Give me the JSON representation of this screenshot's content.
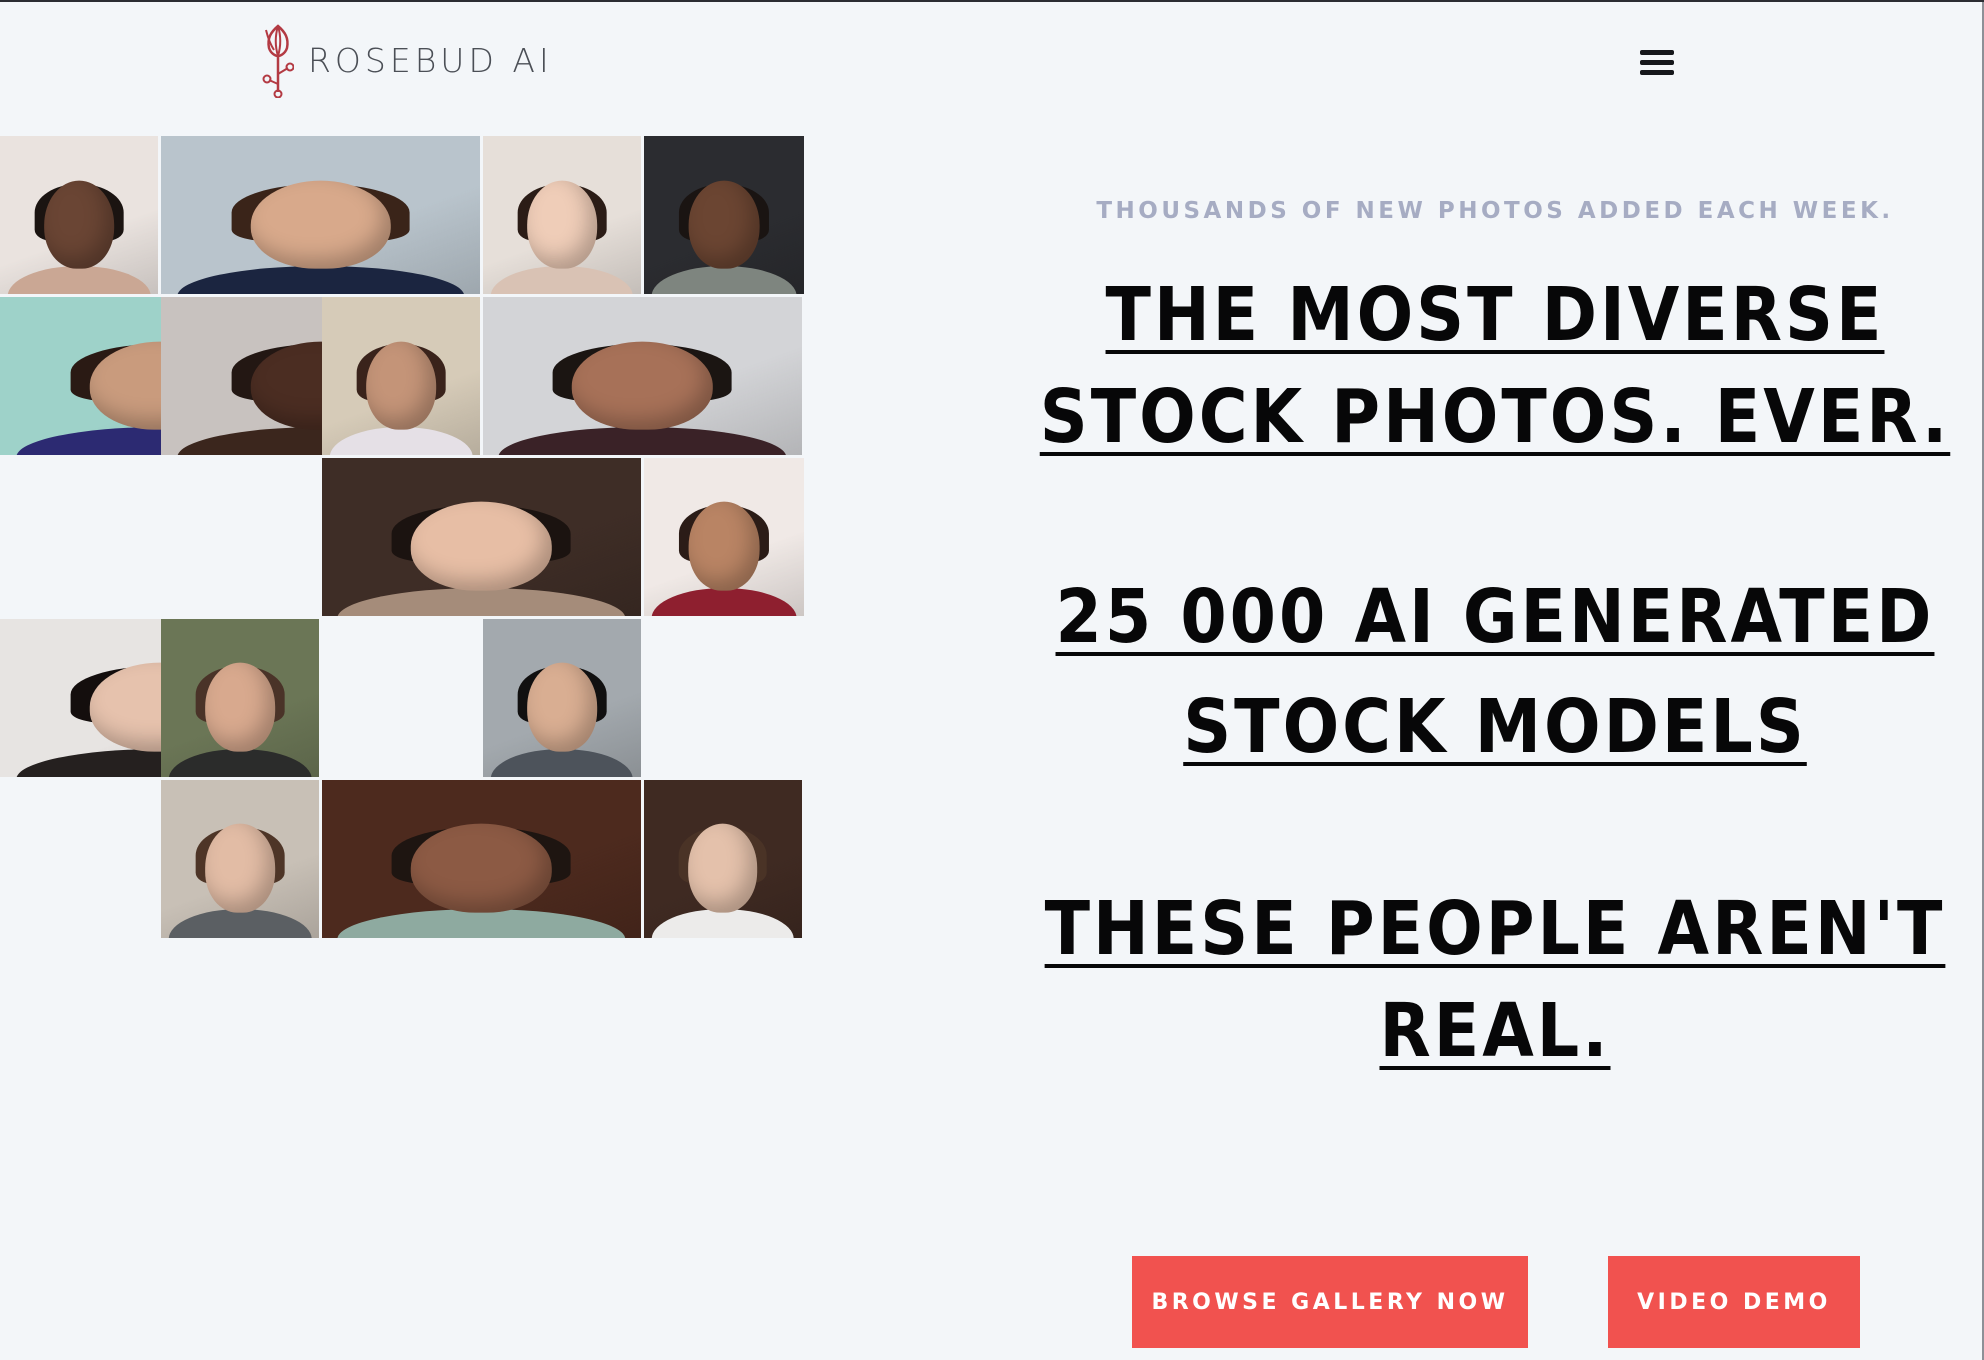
{
  "header": {
    "brand": "ROSEBUD AI",
    "logo_icon": "rose-bud-icon",
    "menu_icon": "hamburger-menu-icon"
  },
  "gallery": {
    "tiles": [
      {
        "name": "portrait-young-man-studio",
        "skin": "#6a4534",
        "hair": "#1b1411",
        "cloth": "#caa794",
        "bg": "#eae3df"
      },
      {
        "name": "portrait-man-suit-glass-hallway",
        "skin": "#d8a98b",
        "hair": "#3a2419",
        "cloth": "#1b2540",
        "bg": "#b9c4cc"
      },
      {
        "name": "portrait-woman-red-lips",
        "skin": "#efcdb8",
        "hair": "#2b1c16",
        "cloth": "#d9c2b4",
        "bg": "#e6dfd9"
      },
      {
        "name": "portrait-woman-grey-jumpsuit-street",
        "skin": "#6b4532",
        "hair": "#1a1412",
        "cloth": "#7e857f",
        "bg": "#2b2c30"
      },
      {
        "name": "portrait-woman-blue-lace-dress",
        "skin": "#c99b7d",
        "hair": "#2a1a14",
        "cloth": "#2c2a72",
        "bg": "#9ed2c9"
      },
      {
        "name": "portrait-woman-dark-skin-closeup",
        "skin": "#4b2d22",
        "hair": "#231713",
        "cloth": "#3b261d",
        "bg": "#c8c2bf"
      },
      {
        "name": "portrait-woman-beach-floral",
        "skin": "#c49478",
        "hair": "#3a231b",
        "cloth": "#e5e0e6",
        "bg": "#d6cbb8"
      },
      {
        "name": "portrait-man-burgundy-suit",
        "skin": "#a77158",
        "hair": "#1b1512",
        "cloth": "#3a2227",
        "bg": "#d3d4d7"
      },
      {
        "name": "portrait-woman-asian-closeup",
        "skin": "#e7bea5",
        "hair": "#1b1310",
        "cloth": "#a58c7a",
        "bg": "#3e2d26"
      },
      {
        "name": "portrait-woman-red-sequin-dress",
        "skin": "#b98464",
        "hair": "#2b1c17",
        "cloth": "#8e1f2f",
        "bg": "#f0e9e6"
      },
      {
        "name": "portrait-woman-bangs-red-lips",
        "skin": "#e6c2ad",
        "hair": "#140e0d",
        "cloth": "#25201f",
        "bg": "#e7e4e2"
      },
      {
        "name": "portrait-woman-hand-face",
        "skin": "#d8a98e",
        "hair": "#4a3328",
        "cloth": "#2b2c2b",
        "bg": "#6b7656"
      },
      {
        "name": "portrait-man-black-hair",
        "skin": "#d9ae92",
        "hair": "#111010",
        "cloth": "#4d535b",
        "bg": "#a3a9ae"
      },
      {
        "name": "portrait-woman-brown-hair-smile",
        "skin": "#e2bca5",
        "hair": "#4e3527",
        "cloth": "#5b5f63",
        "bg": "#c8c0b6"
      },
      {
        "name": "portrait-man-curly-hair-outdoors",
        "skin": "#8c5a44",
        "hair": "#1e1511",
        "cloth": "#8eaaa0",
        "bg": "#4d2a1e"
      },
      {
        "name": "portrait-woman-natural-light",
        "skin": "#e4c1ab",
        "hair": "#4a3326",
        "cloth": "#ecebea",
        "bg": "#3f2a22"
      }
    ]
  },
  "hero": {
    "kicker": "THOUSANDS OF NEW PHOTOS ADDED EACH WEEK.",
    "headline1_line1": "THE MOST DIVERSE",
    "headline1_line2": "STOCK PHOTOS. EVER.",
    "headline2_line1": "25 000 AI GENERATED",
    "headline2_line2": "STOCK MODELS",
    "headline3_line1": "THESE PEOPLE AREN'T",
    "headline3_line2": "REAL."
  },
  "actions": {
    "browse_label": "BROWSE GALLERY NOW",
    "video_label": "VIDEO DEMO",
    "accent": "#f1524f"
  }
}
